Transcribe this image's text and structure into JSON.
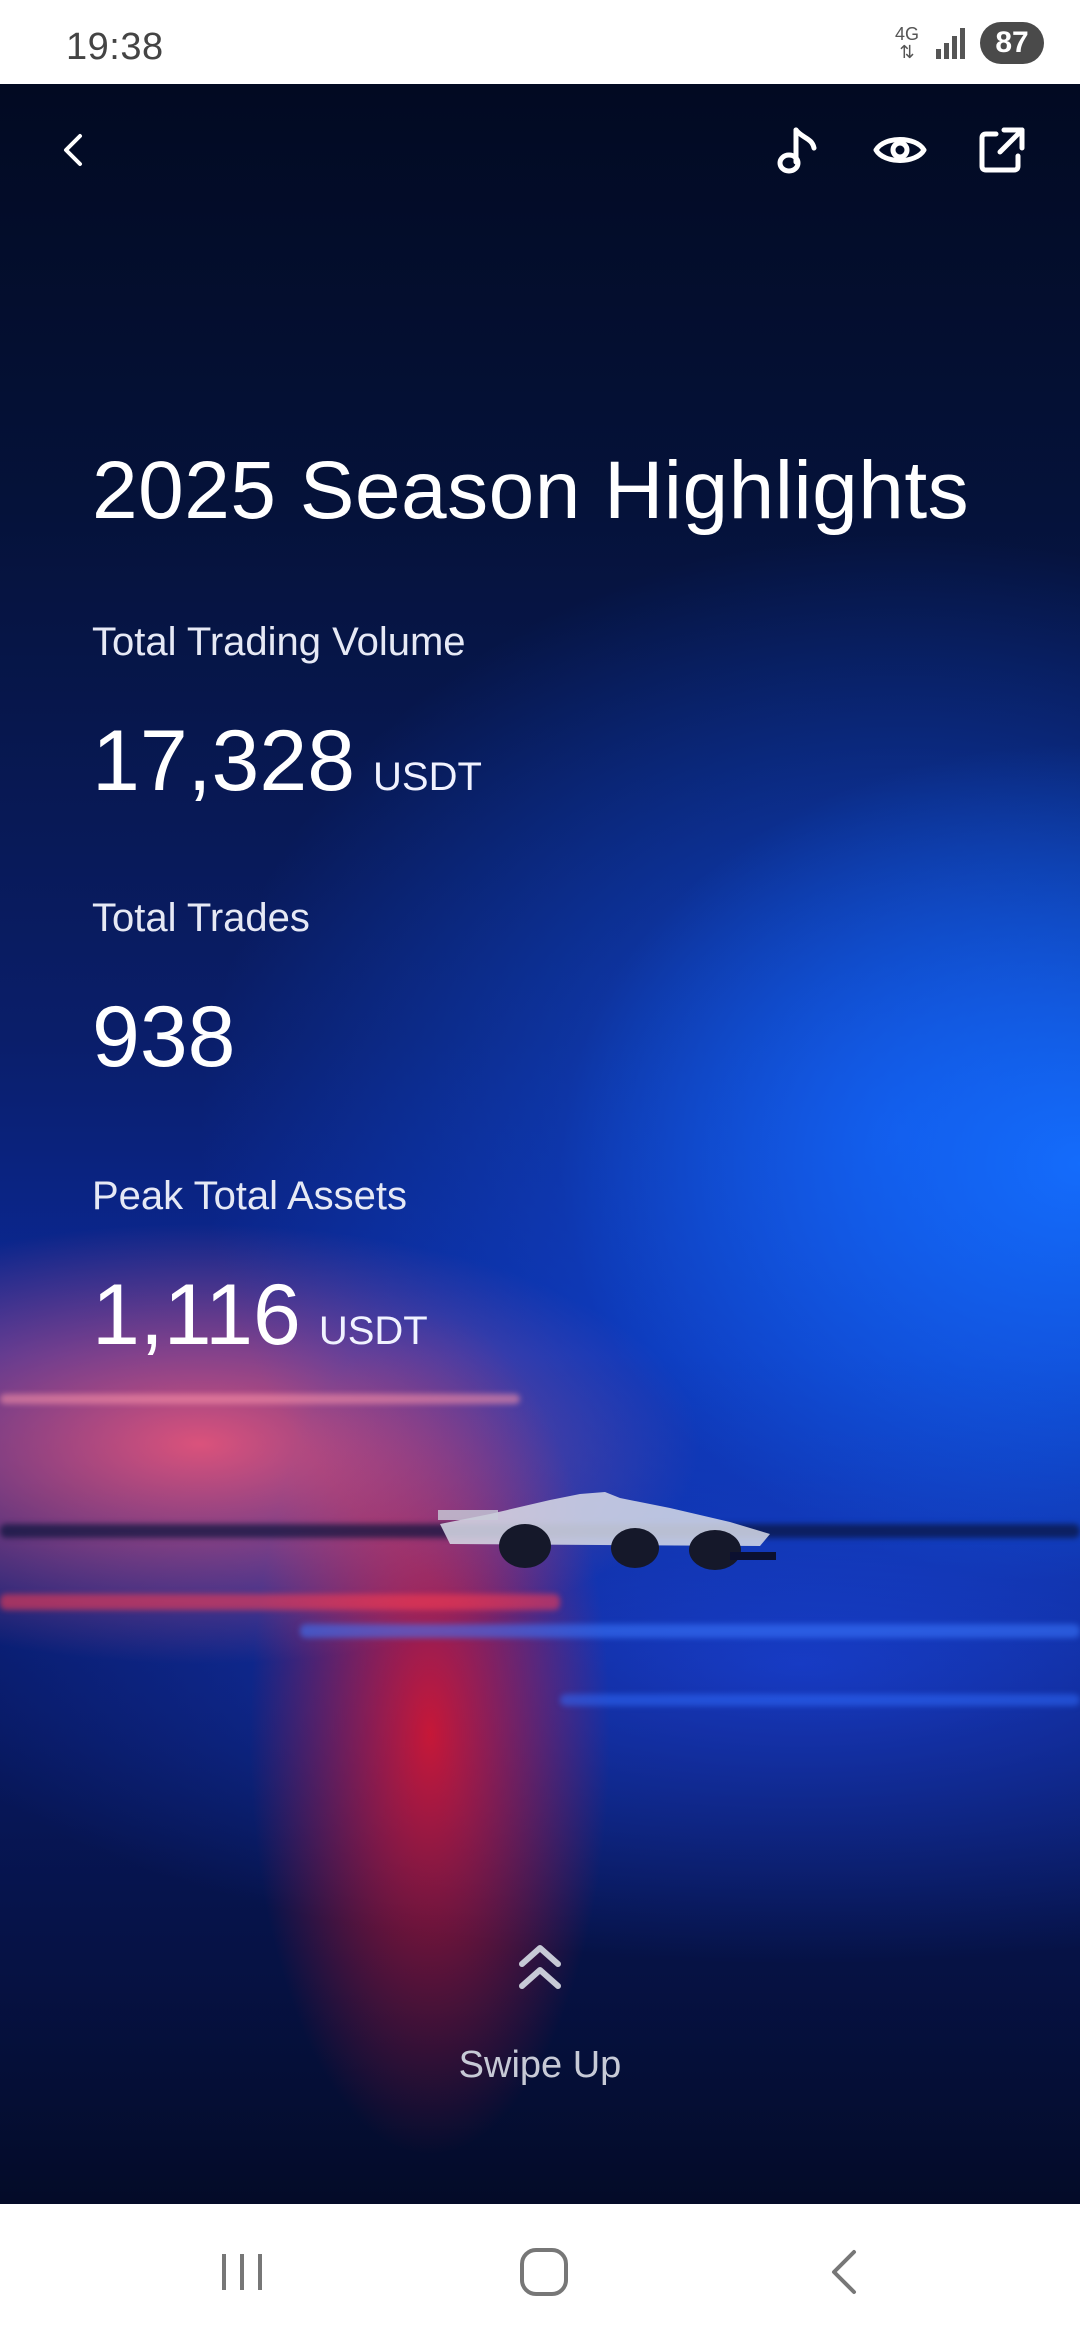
{
  "status_bar": {
    "time": "19:38",
    "network_type": "4G",
    "battery": "87"
  },
  "toolbar": {
    "back_icon": "chevron-left-icon",
    "music_icon": "music-note-icon",
    "visibility_icon": "eye-icon",
    "share_icon": "external-share-icon"
  },
  "highlights": {
    "title": "2025 Season Highlights",
    "stats": [
      {
        "label": "Total Trading Volume",
        "value": "17,328",
        "unit": "USDT"
      },
      {
        "label": "Total Trades",
        "value": "938",
        "unit": ""
      },
      {
        "label": "Peak Total Assets",
        "value": "1,116",
        "unit": "USDT"
      }
    ]
  },
  "swipe": {
    "label": "Swipe Up",
    "icon": "double-chevron-up-icon"
  },
  "nav_bar": {
    "recents_icon": "recents-icon",
    "home_icon": "home-icon",
    "back_icon": "back-icon"
  },
  "colors": {
    "background_dark": "#020a22",
    "accent_blue": "#1466ff",
    "accent_red": "#e61428",
    "text": "#ffffff"
  }
}
